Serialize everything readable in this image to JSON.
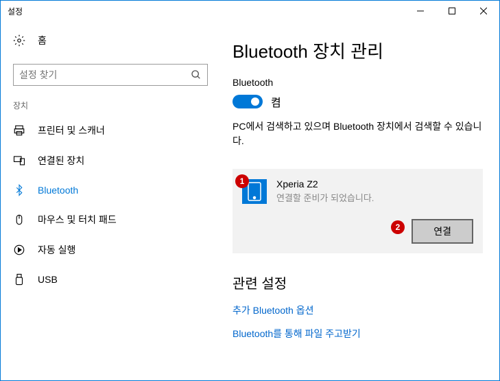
{
  "window": {
    "title": "설정"
  },
  "sidebar": {
    "home_label": "홈",
    "search_placeholder": "설정 찾기",
    "category": "장치",
    "items": [
      {
        "label": "프린터 및 스캐너",
        "active": false
      },
      {
        "label": "연결된 장치",
        "active": false
      },
      {
        "label": "Bluetooth",
        "active": true
      },
      {
        "label": "마우스 및 터치 패드",
        "active": false
      },
      {
        "label": "자동 실행",
        "active": false
      },
      {
        "label": "USB",
        "active": false
      }
    ]
  },
  "main": {
    "title": "Bluetooth 장치 관리",
    "bluetooth_label": "Bluetooth",
    "toggle_state": "켬",
    "discovery_text": "PC에서 검색하고 있으며 Bluetooth 장치에서 검색할 수 있습니다.",
    "device": {
      "name": "Xperia Z2",
      "status": "연결할 준비가 되었습니다.",
      "connect_button": "연결"
    },
    "related": {
      "title": "관련 설정",
      "links": [
        "추가 Bluetooth 옵션",
        "Bluetooth를 통해 파일 주고받기"
      ]
    }
  },
  "annotations": {
    "badge1": "1",
    "badge2": "2"
  }
}
